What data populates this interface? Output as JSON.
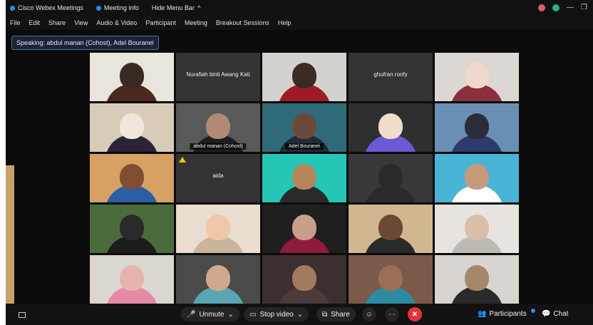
{
  "titlebar": {
    "app": "Cisco Webex Meetings",
    "meeting_info": "Meeting info",
    "hide_menu": "Hide Menu Bar",
    "hide_menu_chevron": "^"
  },
  "menubar": {
    "items": [
      "File",
      "Edit",
      "Share",
      "View",
      "Audio & Video",
      "Participant",
      "Meeting",
      "Breakout Sessions",
      "Help"
    ]
  },
  "speaking": {
    "text": "Speaking: abdul manan (Cohost), Adel Bouranei"
  },
  "tiles": [
    {
      "type": "video",
      "colors": [
        "#e9e4dc",
        "#3a2a24",
        "#4a2a1e"
      ]
    },
    {
      "type": "name",
      "name": "Nurafiah binti Awang Kati"
    },
    {
      "type": "video",
      "colors": [
        "#d3d1cd",
        "#3b2b24",
        "#a11a28"
      ]
    },
    {
      "type": "name",
      "name": "ghufran roofy"
    },
    {
      "type": "video",
      "colors": [
        "#dcd7d3",
        "#f0d7cd",
        "#8b2f3f"
      ]
    },
    {
      "type": "video",
      "colors": [
        "#d8cbb8",
        "#f0e6dc",
        "#2a2436"
      ]
    },
    {
      "type": "video",
      "colors": [
        "#595959",
        "#b08a74",
        "#1d1d1d"
      ],
      "label": "abdul manan (Cohost)",
      "active": true
    },
    {
      "type": "video",
      "colors": [
        "#2f6a79",
        "#6a4a3a",
        "#222b3a"
      ],
      "label": "Adel Bouranei",
      "active": true
    },
    {
      "type": "video",
      "colors": [
        "#2f2f2f",
        "#f0dcc9",
        "#6a5ad6"
      ]
    },
    {
      "type": "video",
      "colors": [
        "#6a8fb4",
        "#2b2b3a",
        "#2e3b6a"
      ]
    },
    {
      "type": "video",
      "colors": [
        "#d7a163",
        "#7f4e31",
        "#2a5fa5"
      ]
    },
    {
      "type": "name",
      "name": "aida",
      "warn": true
    },
    {
      "type": "video",
      "colors": [
        "#25c6b6",
        "#b7855b",
        "#2a2a2a"
      ]
    },
    {
      "type": "video",
      "colors": [
        "#383838",
        "#2a2a2a",
        "#2a2a2a"
      ]
    },
    {
      "type": "video",
      "colors": [
        "#4ab4d6",
        "#c69a7b",
        "#ffffff"
      ]
    },
    {
      "type": "video",
      "colors": [
        "#4a6c3a",
        "#2a2a2a",
        "#1c1c1c"
      ]
    },
    {
      "type": "video",
      "colors": [
        "#e9ddd2",
        "#f0c7a9",
        "#c8b59b"
      ]
    },
    {
      "type": "video",
      "colors": [
        "#1f1f1f",
        "#c79f8a",
        "#8f1b3a"
      ]
    },
    {
      "type": "video",
      "colors": [
        "#d0b78f",
        "#6a4a33",
        "#2a2a2a"
      ]
    },
    {
      "type": "video",
      "colors": [
        "#e7e4df",
        "#d9bfa7",
        "#bfb9b4"
      ]
    },
    {
      "type": "video",
      "colors": [
        "#dcd6d0",
        "#e6b4ad",
        "#e58aa4"
      ]
    },
    {
      "type": "video",
      "colors": [
        "#4a4a4a",
        "#d0a98c",
        "#59a5b3"
      ]
    },
    {
      "type": "video",
      "colors": [
        "#3c2f2f",
        "#a17a5f",
        "#4b3b3b"
      ]
    },
    {
      "type": "video",
      "colors": [
        "#7b5a49",
        "#9b6f55",
        "#2d8aa3"
      ]
    },
    {
      "type": "video",
      "colors": [
        "#d8d4cf",
        "#a5886c",
        "#2b2b2b"
      ]
    }
  ],
  "toolbar": {
    "unmute": "Unmute",
    "stop_video": "Stop video",
    "share": "Share",
    "participants": "Participants",
    "chat": "Chat",
    "more": "···",
    "end": "✕",
    "chevron": "⌄",
    "emoji": "☺",
    "grid_menu": "≡"
  },
  "colors": {
    "accent": "#2d8cff",
    "end": "#e5313b",
    "active_border": "#3aa7d8",
    "panel": "#0b0b0b"
  }
}
